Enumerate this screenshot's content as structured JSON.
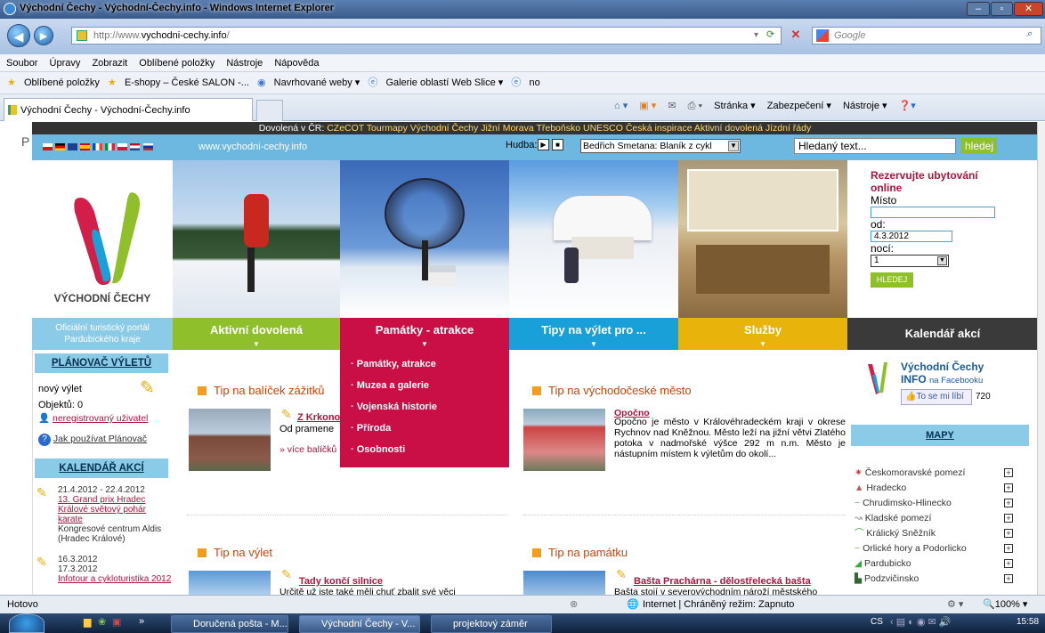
{
  "window": {
    "title": "Východní Čechy - Východní-Čechy.info - Windows Internet Explorer"
  },
  "address": {
    "url_prefix": "http://www.",
    "url_domain": "vychodni-cechy.info",
    "url_suffix": "/",
    "search_placeholder": "Google"
  },
  "menubar": [
    "Soubor",
    "Úpravy",
    "Zobrazit",
    "Oblíbené položky",
    "Nástroje",
    "Nápověda"
  ],
  "favbar": {
    "favorites": "Oblíbené položky",
    "eshopy": "E-shopy – České SALON -...",
    "navrhovane": "Navrhované weby ▾",
    "galerie": "Galerie oblastí Web Slice ▾",
    "no": "no"
  },
  "tab": {
    "title": "Východní Čechy - Východní-Čechy.info"
  },
  "cmdbar": [
    "Stránka ▾",
    "Zabezpečení ▾",
    "Nástroje ▾"
  ],
  "site": {
    "topbar_label": "Dovolená v ČR:",
    "topbar_links": [
      "CZeCOT",
      "Tourmapy",
      "Východní Čechy",
      "Jižní Morava",
      "Třeboňsko",
      "UNESCO",
      "Česká inspirace",
      "Aktivní dovolená",
      "Jízdní řády"
    ],
    "url_text": "www.vychodni-cechy.info",
    "hudba_label": "Hudba:",
    "hudba_selected": "Bedřich Smetana: Blaník z cykl",
    "search_placeholder": "Hledaný text...",
    "search_button": "hledej",
    "logo_text": "VÝCHODNÍ ČECHY",
    "portal_text1": "Oficiální turistický portál",
    "portal_text2": "Pardubického kraje"
  },
  "booking": {
    "title1": "Rezervujte ubytování",
    "title2": "online",
    "misto": "Místo",
    "od": "od:",
    "od_value": "4.3.2012",
    "noci": "nocí:",
    "noci_value": "1",
    "button": "HLEDEJ"
  },
  "nav": [
    "Aktivní dovolená",
    "Památky - atrakce",
    "Tipy na výlet pro ...",
    "Služby",
    "Kalendář akcí"
  ],
  "dropdown": [
    "Památky, atrakce",
    "Muzea a galerie",
    "Vojenská historie",
    "Příroda",
    "Osobnosti"
  ],
  "left": {
    "planovac_title": "PLÁNOVAČ VÝLETŮ",
    "novy_vylet": "nový výlet",
    "objektu": "Objektů: 0",
    "neregistrovany": "neregistrovaný uživatel",
    "jak_pouzivat": "Jak používat Plánovač",
    "kalendar_title": "KALENDÁŘ AKCÍ",
    "event1_date": "21.4.2012 - 22.4.2012",
    "event1_link": "13. Grand prix Hradec Králové světový pohár karate",
    "event1_place": "Kongresové centrum Aldis (Hradec Králové)",
    "event2_date1": "16.3.2012",
    "event2_date2": "17.3.2012",
    "event2_link": "Infotour a cykloturistika 2012"
  },
  "middle": {
    "tip1_head": "Tip na balíček zážitků",
    "tip1_link": "Z Krkono",
    "tip1_text": "Od pramene",
    "tip1_more": "» více balíčků",
    "tip2_head": "Tip na východočeské město",
    "tip2_link": "Opočno",
    "tip2_text": "Opočno je město v Královéhradeckém kraji v okrese Rychnov nad Kněžnou. Město leží na jižní větvi Zlatého potoka v nadmořské výšce 292 m n.m. Město je nástupním místem k výletům do okolí...",
    "tip3_head": "Tip na výlet",
    "tip3_link": "Tady končí silnice",
    "tip3_text": "Určitě už jste také měli chuť zbalit své věci",
    "tip4_head": "Tip na památku",
    "tip4_link": "Bašta Prachárna - dělostřelecká bašta",
    "tip4_text": "Bašta stojí v severovýchodním nároží městského"
  },
  "right": {
    "fb_title": "Východní Čechy",
    "fb_info": "INFO",
    "fb_on": "na Facebooku",
    "fb_like": "To se mi líbí",
    "fb_count": "720",
    "mapy": "MAPY",
    "maps": [
      "Českomoravské pomezí",
      "Hradecko",
      "Chrudimsko-Hlinecko",
      "Kladské pomezí",
      "Králický Sněžník",
      "Orlické hory a Podorlicko",
      "Pardubicko",
      "Podzvičinsko"
    ]
  },
  "status": {
    "left": "Hotovo",
    "zone": "Internet | Chráněný režim: Zapnuto",
    "zoom": "100%"
  },
  "taskbar": {
    "btn1": "Doručená pošta - M...",
    "btn2": "Východní Čechy - V...",
    "btn3": "projektový záměr",
    "lang": "CS",
    "time": "15:58"
  },
  "colors": {
    "green": "#8fbf2a",
    "red": "#c90f45",
    "blue": "#1aa0d8",
    "yellow": "#e8b40c",
    "dark": "#3a3a3a",
    "lightblue": "#8ccbe8"
  }
}
